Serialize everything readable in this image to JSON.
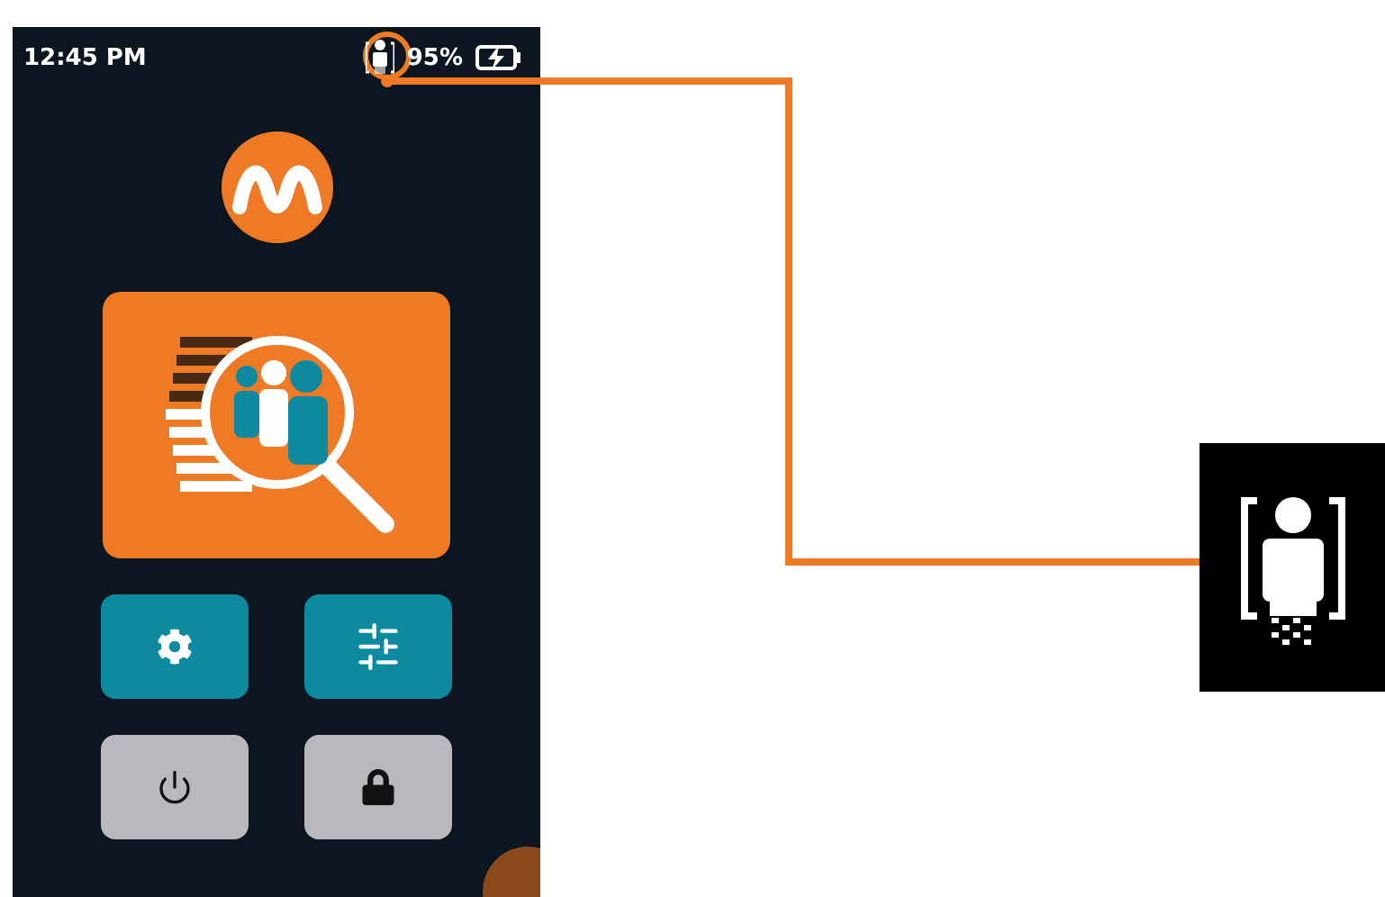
{
  "status_bar": {
    "time": "12:45 PM",
    "battery": "95%",
    "charging": true
  },
  "tiles": [
    {
      "kind": "settings"
    },
    {
      "kind": "adjust"
    },
    {
      "kind": "power"
    },
    {
      "kind": "lock"
    }
  ]
}
